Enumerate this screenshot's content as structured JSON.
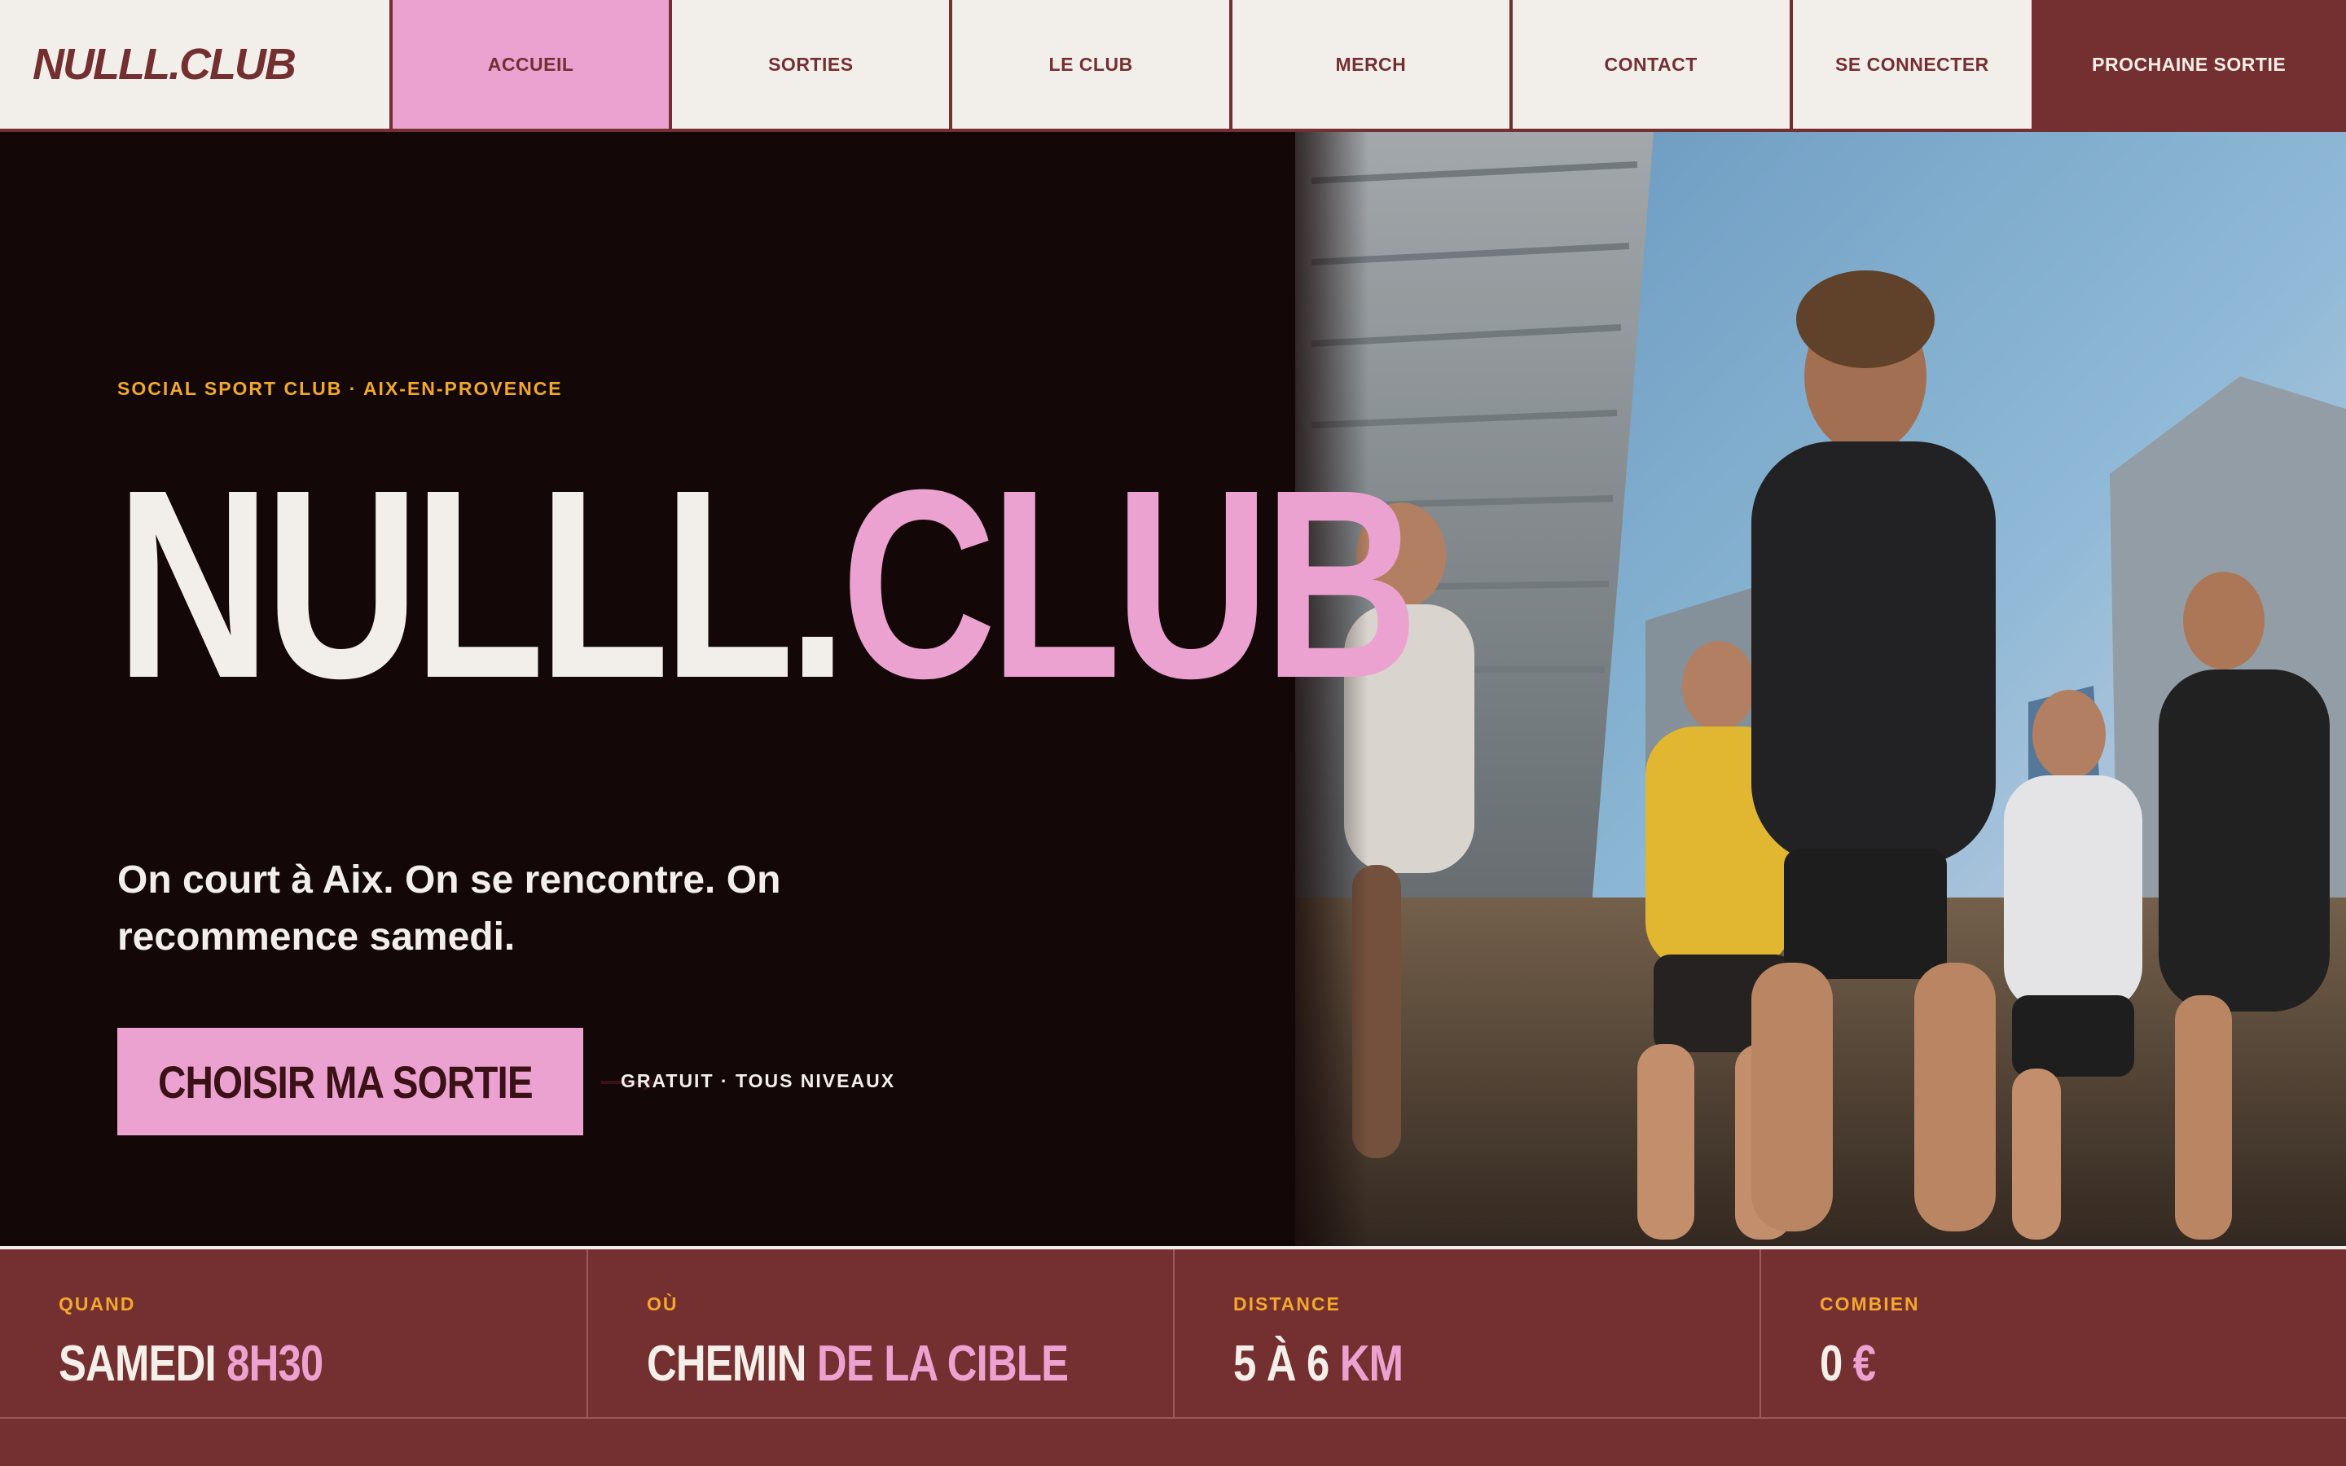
{
  "nav": {
    "logo": "NULLL.CLUB",
    "items": [
      "ACCUEIL",
      "SORTIES",
      "LE CLUB",
      "MERCH",
      "CONTACT",
      "SE CONNECTER"
    ],
    "active_index": 0,
    "cta": "PROCHAINE SORTIE"
  },
  "hero": {
    "eyebrow": "SOCIAL SPORT CLUB · AIX-EN-PROVENCE",
    "title_part1": "NULLL.",
    "title_part2": "CLUB",
    "subtitle": "On court à Aix. On se rencontre. On recommence samedi.",
    "cta_label": "CHOISIR MA SORTIE",
    "cta_icon": "arrow-right-icon",
    "cta_note": "GRATUIT · TOUS NIVEAUX",
    "image": "group-of-runners-city-photo"
  },
  "info": [
    {
      "label": "QUAND",
      "value_a": "SAMEDI",
      "value_b": "8H30"
    },
    {
      "label": "OÙ",
      "value_a": "CHEMIN",
      "value_b": "DE LA CIBLE"
    },
    {
      "label": "DISTANCE",
      "value_a": "5 À 6",
      "value_b": "KM"
    },
    {
      "label": "COMBIEN",
      "value_a": "0",
      "value_b": "€"
    }
  ],
  "colors": {
    "burgundy": "#742f31",
    "pink": "#eba2d1",
    "cream": "#f2efea",
    "amber": "#f2a92b",
    "dark": "#140707"
  }
}
